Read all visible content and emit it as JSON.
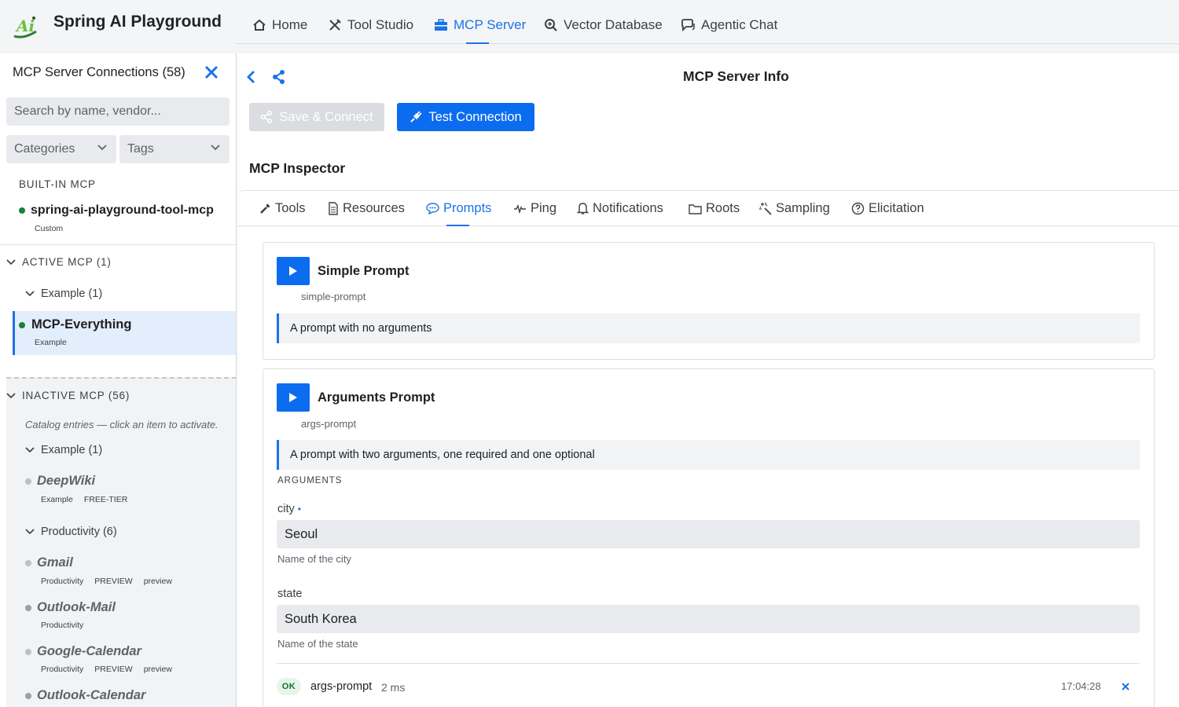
{
  "app": {
    "title": "Spring AI Playground"
  },
  "nav": [
    {
      "label": "Home",
      "icon": "home-icon"
    },
    {
      "label": "Tool Studio",
      "icon": "tools-icon"
    },
    {
      "label": "MCP Server",
      "icon": "briefcase-icon",
      "active": true
    },
    {
      "label": "Vector Database",
      "icon": "search-db-icon"
    },
    {
      "label": "Agentic Chat",
      "icon": "chat-icon"
    }
  ],
  "sidebar": {
    "title": "MCP Server Connections (58)",
    "search_placeholder": "Search by name, vendor...",
    "filters": {
      "categories": "Categories",
      "tags": "Tags"
    },
    "builtin": {
      "section": "BUILT-IN MCP",
      "item": {
        "name": "spring-ai-playground-tool-mcp",
        "meta": "Custom"
      }
    },
    "active": {
      "section": "ACTIVE MCP (1)",
      "group": "Example (1)",
      "item": {
        "name": "MCP-Everything",
        "meta": "Example"
      }
    },
    "inactive": {
      "section": "INACTIVE MCP (56)",
      "note": "Catalog entries — click an item to activate.",
      "group1": "Example (1)",
      "group2": "Productivity (6)",
      "items": [
        {
          "name": "DeepWiki",
          "tags": [
            "Example",
            "FREE-TIER"
          ]
        },
        {
          "name": "Gmail",
          "tags": [
            "Productivity",
            "PREVIEW",
            "preview"
          ]
        },
        {
          "name": "Outlook-Mail",
          "tags": [
            "Productivity"
          ]
        },
        {
          "name": "Google-Calendar",
          "tags": [
            "Productivity",
            "PREVIEW",
            "preview"
          ]
        },
        {
          "name": "Outlook-Calendar",
          "tags": []
        }
      ]
    }
  },
  "main": {
    "title": "MCP Server Info",
    "save_label": "Save & Connect",
    "test_label": "Test Connection",
    "inspector_title": "MCP Inspector",
    "tabs": [
      {
        "label": "Tools",
        "icon": "wrench-icon"
      },
      {
        "label": "Resources",
        "icon": "document-icon"
      },
      {
        "label": "Prompts",
        "icon": "speech-bubble-icon",
        "active": true
      },
      {
        "label": "Ping",
        "icon": "pulse-icon"
      },
      {
        "label": "Notifications",
        "icon": "bell-icon"
      },
      {
        "label": "Roots",
        "icon": "folder-icon"
      },
      {
        "label": "Sampling",
        "icon": "magic-wand-icon"
      },
      {
        "label": "Elicitation",
        "icon": "question-circle-icon"
      }
    ],
    "prompts": [
      {
        "title": "Simple Prompt",
        "id": "simple-prompt",
        "description": "A prompt with no arguments"
      },
      {
        "title": "Arguments Prompt",
        "id": "args-prompt",
        "description": "A prompt with two arguments, one required and one optional",
        "arguments_label": "ARGUMENTS",
        "arguments": [
          {
            "name": "city",
            "required_mark": "•",
            "value": "Seoul",
            "help": "Name of the city"
          },
          {
            "name": "state",
            "value": "South Korea",
            "help": "Name of the state"
          }
        ],
        "result": {
          "status": "OK",
          "name": "args-prompt",
          "duration": "2 ms",
          "timestamp": "17:04:28"
        }
      }
    ]
  },
  "colors": {
    "accent": "#1a73e8",
    "button": "#0b6cf0",
    "active_dot": "#188038"
  }
}
